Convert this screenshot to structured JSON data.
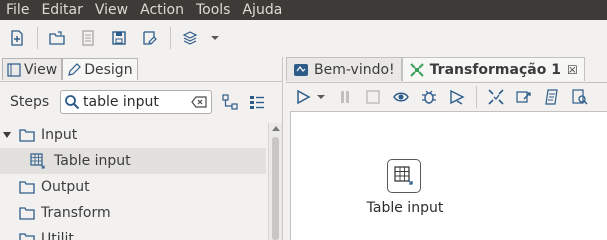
{
  "menu": [
    "File",
    "Editar",
    "View",
    "Action",
    "Tools",
    "Ajuda"
  ],
  "left_panel": {
    "tabs": [
      {
        "label": "View",
        "icon": "view-icon"
      },
      {
        "label": "Design",
        "icon": "pencil-icon"
      }
    ],
    "steps_label": "Steps",
    "search_value": "table input",
    "tree": [
      {
        "label": "Input",
        "type": "folder",
        "expanded": true
      },
      {
        "label": "Table input",
        "type": "step",
        "selected": true
      },
      {
        "label": "Output",
        "type": "folder"
      },
      {
        "label": "Transform",
        "type": "folder"
      },
      {
        "label": "Utilit",
        "type": "folder"
      }
    ]
  },
  "editor": {
    "tabs": [
      {
        "label": "Bem-vindo!",
        "icon": "welcome-icon"
      },
      {
        "label": "Transformação 1",
        "icon": "transformation-icon",
        "close": "☒"
      }
    ]
  },
  "canvas": {
    "node_label": "Table input"
  },
  "colors": {
    "menubar_bg": "#3c3b37",
    "accent": "#2e5c8a",
    "canvas_bg": "#ffffff"
  }
}
